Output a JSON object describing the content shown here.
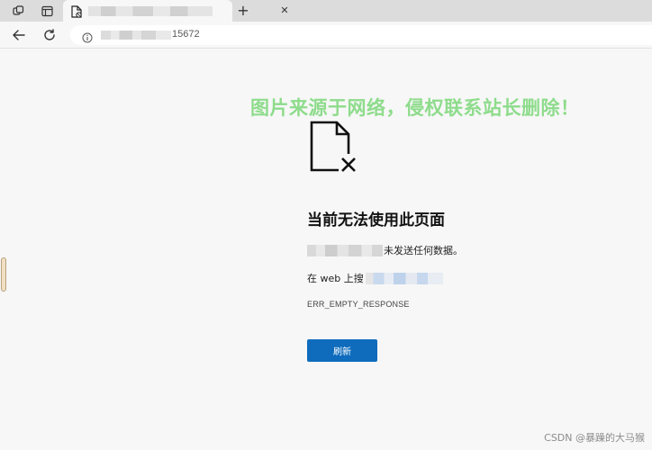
{
  "tabstrip": {
    "workspaces_icon": "workspaces-icon",
    "vertical_tabs_icon": "vertical-tabs-icon",
    "tab": {
      "favicon": "error-page-icon",
      "close_glyph": "✕"
    },
    "new_tab_glyph": "+"
  },
  "toolbar": {
    "back_icon": "back-arrow-icon",
    "refresh_icon": "refresh-icon",
    "address": {
      "info_icon": "info-icon",
      "visible_text": "15672"
    }
  },
  "watermark": "图片来源于网络，侵权联系站长删除！",
  "error": {
    "icon": "document-x-icon",
    "title": "当前无法使用此页面",
    "message_suffix": "未发送任何数据。",
    "search_prefix": "在 web 上搜",
    "code": "ERR_EMPTY_RESPONSE",
    "refresh_label": "刷新"
  },
  "credit": "CSDN @暴躁的大马猴",
  "colors": {
    "accent": "#0f6cbd",
    "watermark": "#8edc8c",
    "page_bg": "#f7f7f7",
    "tabstrip_bg": "#dcdcdc"
  }
}
